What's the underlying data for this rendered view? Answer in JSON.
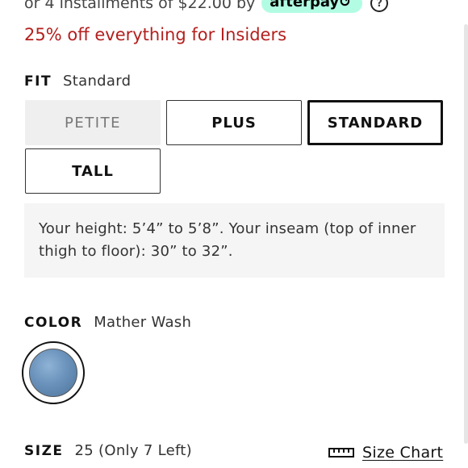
{
  "payment": {
    "installments_text": "or 4 installments of $22.00 by",
    "afterpay_label": "afterpay↺",
    "help_symbol": "?"
  },
  "promo": {
    "text": "25% off everything for Insiders",
    "color": "#b3201e"
  },
  "fit": {
    "label": "FIT",
    "selected_value": "Standard",
    "options": [
      {
        "label": "PETITE",
        "state": "disabled"
      },
      {
        "label": "PLUS",
        "state": "available"
      },
      {
        "label": "STANDARD",
        "state": "selected"
      },
      {
        "label": "TALL",
        "state": "available"
      }
    ],
    "info_text": "Your height: 5’4” to 5’8”. Your inseam (top of inner thigh to floor): 30” to 32”."
  },
  "color": {
    "label": "COLOR",
    "selected_value": "Mather Wash",
    "swatch_color": "#6a92bb"
  },
  "size": {
    "label": "SIZE",
    "selected_value": "25 (Only 7 Left)",
    "chart_link": "Size Chart",
    "chart_icon": "ruler-icon"
  }
}
